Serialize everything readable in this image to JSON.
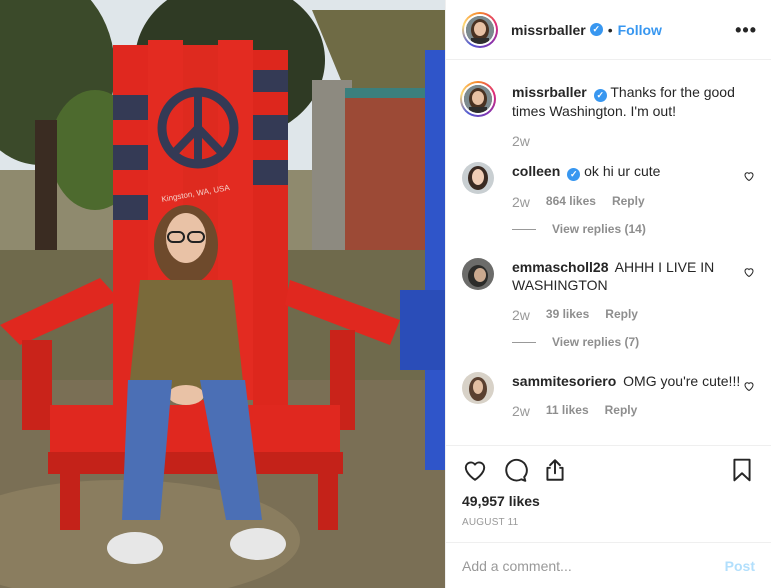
{
  "post": {
    "username": "missrballer",
    "follow_label": "Follow",
    "separator": "•",
    "more_label": "•••",
    "likes": "49,957 likes",
    "date": "AUGUST 11"
  },
  "caption": {
    "username": "missrballer",
    "text": "Thanks for the good times Washington. I'm out!",
    "time": "2w"
  },
  "comments": [
    {
      "username": "colleen",
      "verified": true,
      "text": "ok hi ur cute",
      "time": "2w",
      "likes": "864 likes",
      "reply_label": "Reply",
      "view_replies": "View replies (14)"
    },
    {
      "username": "emmascholl28",
      "verified": false,
      "text": "AHHH I LIVE IN WASHINGTON",
      "time": "2w",
      "likes": "39 likes",
      "reply_label": "Reply",
      "view_replies": "View replies (7)"
    },
    {
      "username": "sammitesoriero",
      "verified": false,
      "text": "OMG you're cute!!!",
      "time": "2w",
      "likes": "11 likes",
      "reply_label": "Reply"
    }
  ],
  "photo": {
    "chair_text": "Kingston, WA, USA"
  },
  "add_comment": {
    "placeholder": "Add a comment...",
    "post_label": "Post"
  },
  "icons": {
    "like": "heart-icon",
    "comment": "comment-icon",
    "share": "share-icon",
    "save": "bookmark-icon",
    "verified": "verified-badge-icon"
  },
  "colors": {
    "accent": "#3897f0",
    "post_disabled": "#b2dffc",
    "chair_red": "#e0281f",
    "text_secondary": "#8e8e8e"
  }
}
